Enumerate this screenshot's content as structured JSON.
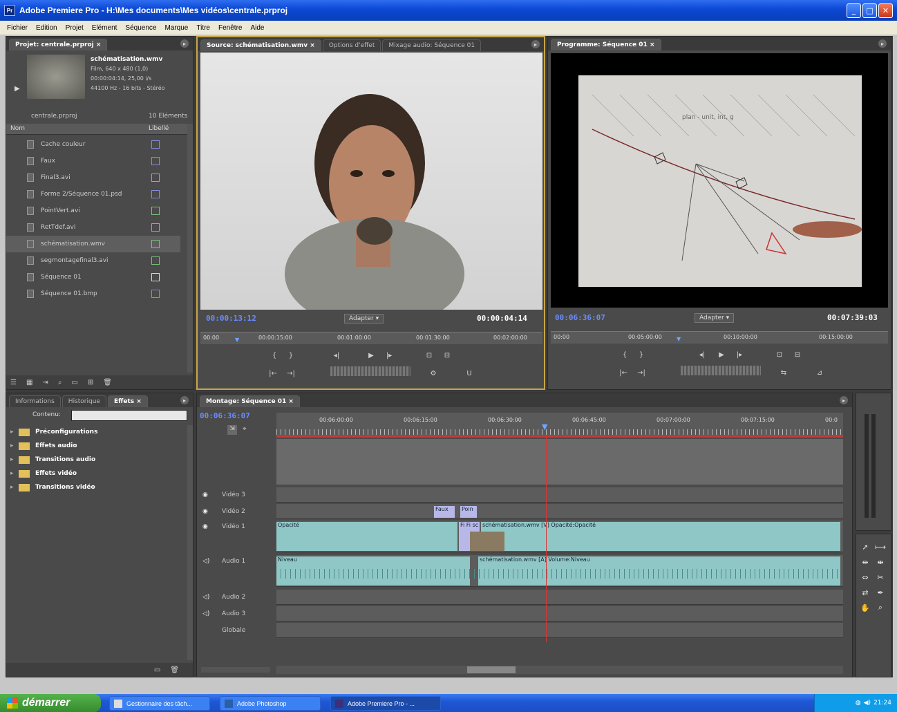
{
  "window": {
    "title": "Adobe Premiere Pro - H:\\Mes documents\\Mes vidéos\\centrale.prproj"
  },
  "menu": [
    "Fichier",
    "Edition",
    "Projet",
    "Elément",
    "Séquence",
    "Marque",
    "Titre",
    "Fenêtre",
    "Aide"
  ],
  "project": {
    "tab": "Projet: centrale.prproj",
    "preview": {
      "name": "schématisation.wmv",
      "line1": "Film, 640 x 480 (1,0)",
      "line2": "00:00:04:14, 25,00 i/s",
      "line3": "44100 Hz - 16 bits - Stéréo"
    },
    "bin_name": "centrale.prproj",
    "count": "10 Eléments",
    "col_name": "Nom",
    "col_label": "Libellé",
    "items": [
      "Cache couleur",
      "Faux",
      "Final3.avi",
      "Forme 2/Séquence 01.psd",
      "PointVert.avi",
      "RetTdef.avi",
      "schématisation.wmv",
      "segmontagefinal3.avi",
      "Séquence 01",
      "Séquence 01.bmp"
    ],
    "selected_index": 6
  },
  "effects_panel": {
    "tabs": [
      "Informations",
      "Historique",
      "Effets"
    ],
    "search_label": "Contenu:",
    "search_value": "",
    "folders": [
      "Préconfigurations",
      "Effets audio",
      "Transitions audio",
      "Effets vidéo",
      "Transitions vidéo"
    ]
  },
  "source": {
    "tabs": [
      "Source: schématisation.wmv",
      "Options d'effet",
      "Mixage audio: Séquence 01"
    ],
    "timecode_in": "00:00:13:12",
    "fit": "Adapter",
    "duration": "00:00:04:14",
    "ruler": [
      "00:00",
      "00:00:15:00",
      "00:01:00:00",
      "00:01:30:00",
      "00:02:00:00"
    ]
  },
  "program": {
    "tab": "Programme: Séquence 01",
    "timecode_in": "00:06:36:07",
    "fit": "Adapter",
    "duration": "00:07:39:03",
    "ruler": [
      "00:00",
      "00:05:00:00",
      "00:10:00:00",
      "00:15:00:00"
    ],
    "board_text": "plan - unit, int, g"
  },
  "timeline": {
    "tab": "Montage: Séquence 01",
    "timecode": "00:06:36:07",
    "ruler": [
      "00:06:00:00",
      "00:06:15:00",
      "00:06:30:00",
      "00:06:45:00",
      "00:07:00:00",
      "00:07:15:00",
      "00:0"
    ],
    "tracks": [
      "Vidéo 3",
      "Vidéo 2",
      "Vidéo 1",
      "Audio 1",
      "Audio 2",
      "Audio 3",
      "Globale"
    ],
    "v2_clips": [
      "Faux",
      "Poin"
    ],
    "v1_left": "Opacité",
    "v1_right": "schématisation.wmv [V] Opacité:Opacité",
    "v1_small": "Fi Fi sc",
    "a1_left": "Niveau",
    "a1_right": "schématisation.wmv [A] Volume:Niveau"
  },
  "taskbar": {
    "start": "démarrer",
    "items": [
      "Gestionnaire des tâch...",
      "Adobe Photoshop",
      "Adobe Premiere Pro - ..."
    ],
    "clock": "21:24"
  }
}
